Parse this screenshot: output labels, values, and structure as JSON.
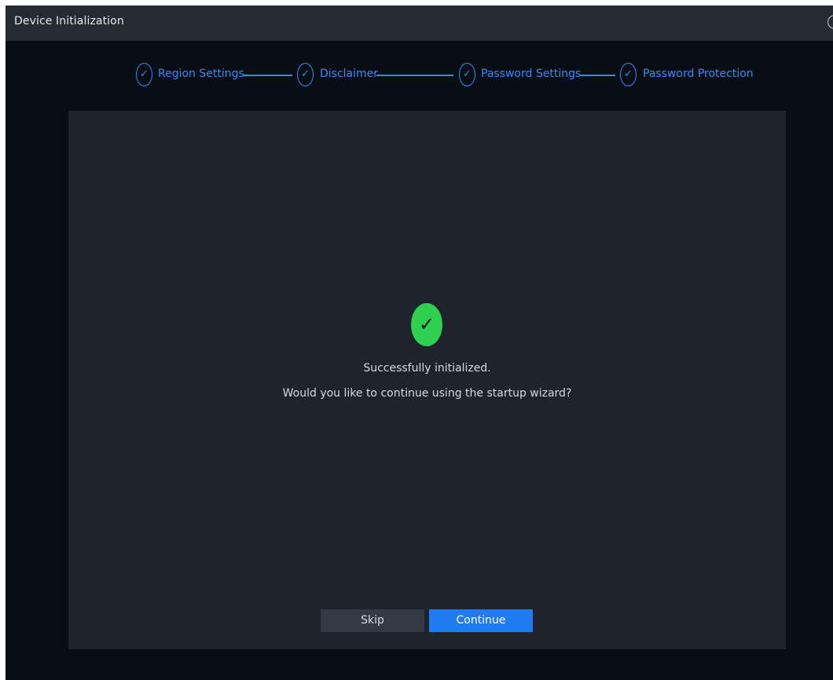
{
  "window": {
    "title": "Device Initialization"
  },
  "stepper": {
    "steps": [
      {
        "label": "Region Settings",
        "status": "done",
        "icon": "check-icon"
      },
      {
        "label": "Disclaimer",
        "status": "done",
        "icon": "check-icon"
      },
      {
        "label": "Password Settings",
        "status": "done",
        "icon": "check-icon"
      },
      {
        "label": "Password Protection",
        "status": "done",
        "icon": "check-icon"
      }
    ],
    "check_glyph": "✓"
  },
  "main": {
    "success_glyph": "✓",
    "message": "Successfully initialized.",
    "question": "Would you like to continue using the startup wizard?"
  },
  "buttons": {
    "skip_label": "Skip",
    "continue_label": "Continue"
  },
  "colors": {
    "accent": "#2f8cff",
    "primary_button": "#1e7bf2",
    "success": "#2fcf4f",
    "background": "#090d14",
    "panel": "#1f242c"
  }
}
